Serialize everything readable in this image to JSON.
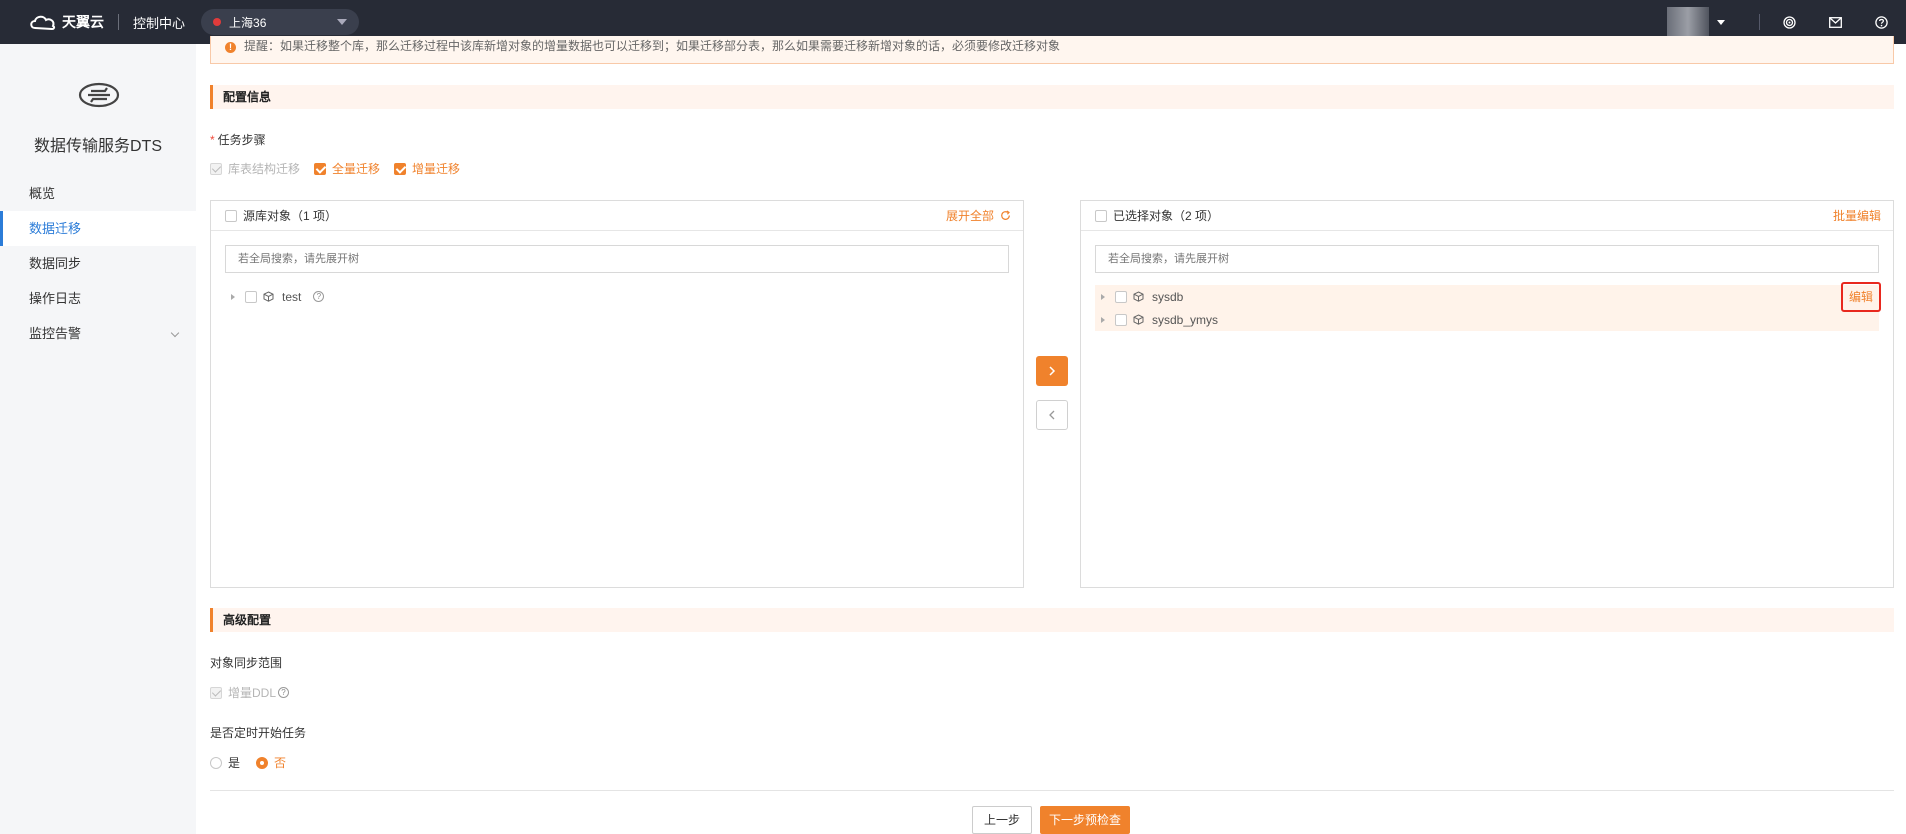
{
  "topbar": {
    "brand": "天翼云",
    "console": "控制中心",
    "region": "上海36"
  },
  "sidebar": {
    "title": "数据传输服务DTS",
    "items": [
      {
        "label": "概览"
      },
      {
        "label": "数据迁移"
      },
      {
        "label": "数据同步"
      },
      {
        "label": "操作日志"
      },
      {
        "label": "监控告警"
      }
    ]
  },
  "notice": {
    "text": "提醒：如果迁移整个库，那么迁移过程中该库新增对象的增量数据也可以迁移到；如果迁移部分表，那么如果需要迁移新增对象的话，必须要修改迁移对象"
  },
  "config": {
    "section_title": "配置信息",
    "task_steps_label": "任务步骤",
    "steps": [
      {
        "label": "库表结构迁移"
      },
      {
        "label": "全量迁移"
      },
      {
        "label": "增量迁移"
      }
    ]
  },
  "source_panel": {
    "title": "源库对象（1 项）",
    "action": "展开全部",
    "search_placeholder": "若全局搜索，请先展开树",
    "items": [
      {
        "name": "test"
      }
    ]
  },
  "selected_panel": {
    "title": "已选择对象（2 项）",
    "action": "批量编辑",
    "search_placeholder": "若全局搜索，请先展开树",
    "items": [
      {
        "name": "sysdb",
        "edit": "编辑"
      },
      {
        "name": "sysdb_ymys"
      }
    ]
  },
  "advanced": {
    "section_title": "高级配置",
    "sync_scope_label": "对象同步范围",
    "ddl_label": "增量DDL",
    "scheduled_label": "是否定时开始任务",
    "yes": "是",
    "no": "否"
  },
  "footer": {
    "prev": "上一步",
    "next": "下一步预检查"
  }
}
